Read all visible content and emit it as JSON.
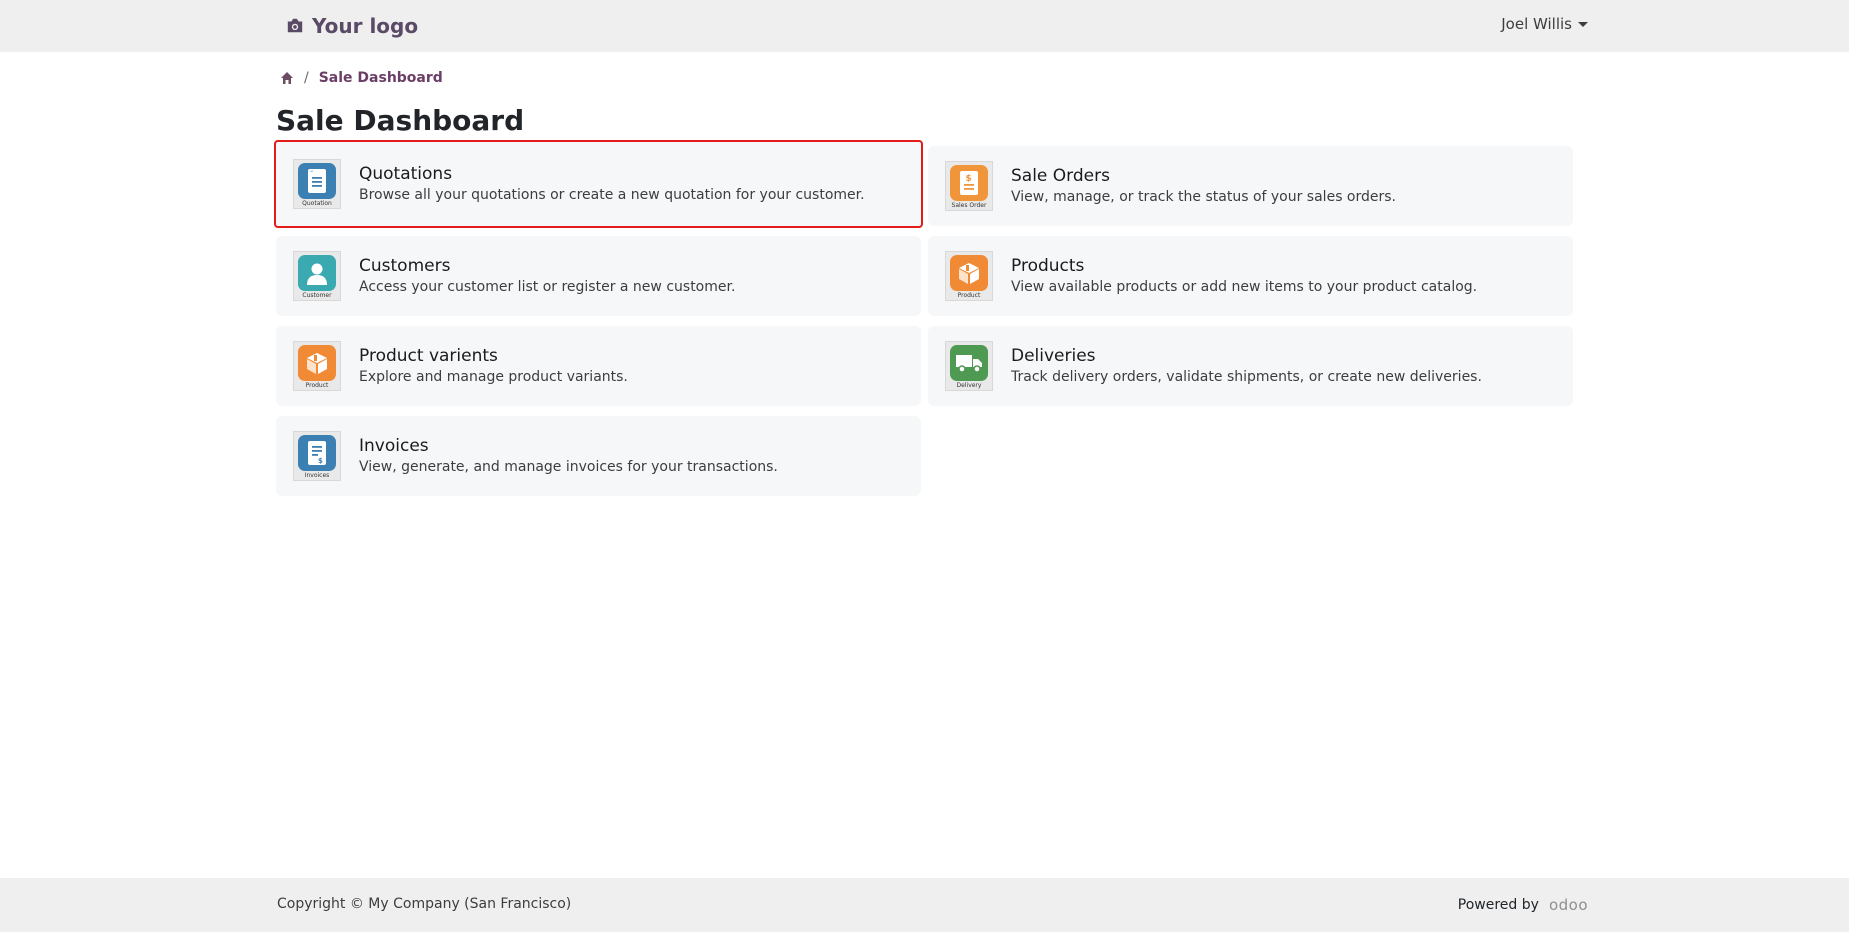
{
  "header": {
    "logo_text": "Your logo",
    "user_name": "Joel Willis"
  },
  "breadcrumb": {
    "current": "Sale Dashboard"
  },
  "page_title": "Sale Dashboard",
  "cards": [
    {
      "title": "Quotations",
      "description": "Browse all your quotations or create a new quotation for your customer.",
      "icon": "quotation-icon",
      "icon_caption": "Quotation",
      "color": "#3b7fb3",
      "selected": true
    },
    {
      "title": "Sale Orders",
      "description": "View, manage, or track the status of your sales orders.",
      "icon": "sales-order-icon",
      "icon_caption": "Sales Order",
      "color": "#f0953a",
      "selected": false
    },
    {
      "title": "Customers",
      "description": "Access your customer list or register a new customer.",
      "icon": "customer-icon",
      "icon_caption": "Customer",
      "color": "#3aaab0",
      "selected": false
    },
    {
      "title": "Products",
      "description": "View available products or add new items to your product catalog.",
      "icon": "product-icon",
      "icon_caption": "Product",
      "color": "#f08a35",
      "selected": false
    },
    {
      "title": "Product varients",
      "description": "Explore and manage product variants.",
      "icon": "product-icon",
      "icon_caption": "Product",
      "color": "#f08a35",
      "selected": false
    },
    {
      "title": "Deliveries",
      "description": "Track delivery orders, validate shipments, or create new deliveries.",
      "icon": "delivery-icon",
      "icon_caption": "Delivery",
      "color": "#4f9a52",
      "selected": false
    },
    {
      "title": "Invoices",
      "description": "View, generate, and manage invoices for your transactions.",
      "icon": "invoice-icon",
      "icon_caption": "Invoices",
      "color": "#3b7fb3",
      "selected": false
    }
  ],
  "footer": {
    "copyright": "Copyright © My Company (San Francisco)",
    "powered_by": "Powered by",
    "brand": "odoo"
  },
  "colors": {
    "accent": "#6b3e66",
    "selection_outline": "#e31b1b"
  }
}
